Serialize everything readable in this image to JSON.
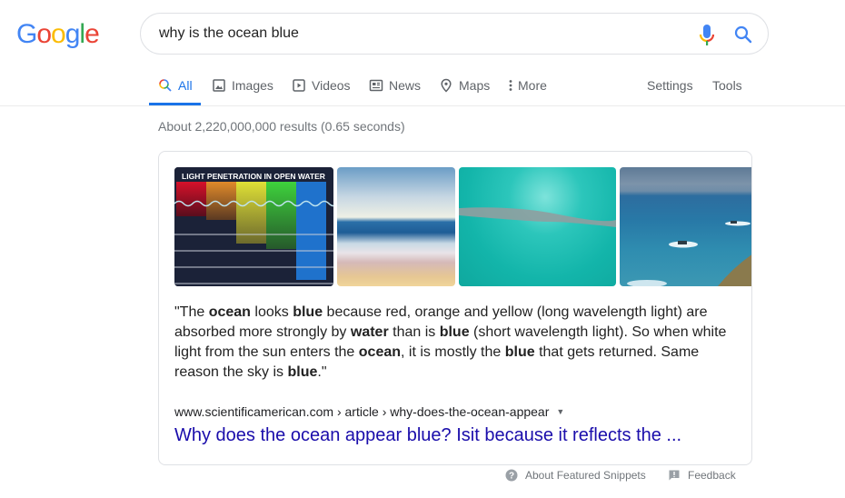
{
  "logo": {
    "letters": [
      {
        "ch": "G",
        "color": "#4285F4"
      },
      {
        "ch": "o",
        "color": "#EA4335"
      },
      {
        "ch": "o",
        "color": "#FBBC05"
      },
      {
        "ch": "g",
        "color": "#4285F4"
      },
      {
        "ch": "l",
        "color": "#34A853"
      },
      {
        "ch": "e",
        "color": "#EA4335"
      }
    ]
  },
  "search": {
    "query": "why is the ocean blue",
    "mic_icon": "microphone-icon",
    "search_icon": "magnifier-icon"
  },
  "tabs": {
    "all": "All",
    "images": "Images",
    "videos": "Videos",
    "news": "News",
    "maps": "Maps",
    "more": "More",
    "settings": "Settings",
    "tools": "Tools",
    "active": "All"
  },
  "results_stats": "About 2,220,000,000 results (0.65 seconds)",
  "featured_snippet": {
    "images": [
      {
        "alt": "Light penetration in open water diagram",
        "caption": "LIGHT PENETRATION IN OPEN WATER"
      },
      {
        "alt": "Beach with waves"
      },
      {
        "alt": "Aerial view of road across turquoise water"
      },
      {
        "alt": "Boats on blue sea near cliff"
      }
    ],
    "quote_segments": [
      {
        "text": "\"The ",
        "bold": false
      },
      {
        "text": "ocean",
        "bold": true
      },
      {
        "text": " looks ",
        "bold": false
      },
      {
        "text": "blue",
        "bold": true
      },
      {
        "text": " because red, orange and yellow (long wavelength light) are absorbed more strongly by ",
        "bold": false
      },
      {
        "text": "water",
        "bold": true
      },
      {
        "text": " than is ",
        "bold": false
      },
      {
        "text": "blue",
        "bold": true
      },
      {
        "text": " (short wavelength light). So when white light from the sun enters the ",
        "bold": false
      },
      {
        "text": "ocean",
        "bold": true
      },
      {
        "text": ", it is mostly the ",
        "bold": false
      },
      {
        "text": "blue",
        "bold": true
      },
      {
        "text": " that gets returned. Same reason the sky is ",
        "bold": false
      },
      {
        "text": "blue",
        "bold": true
      },
      {
        "text": ".\"",
        "bold": false
      }
    ],
    "cite": "www.scientificamerican.com › article › why-does-the-ocean-appear",
    "title": "Why does the ocean appear blue? Isit because it reflects the ..."
  },
  "footer": {
    "about": "About Featured Snippets",
    "feedback": "Feedback"
  },
  "colors": {
    "accent": "#1a73e8",
    "link": "#1a0dab",
    "muted": "#70757a"
  }
}
